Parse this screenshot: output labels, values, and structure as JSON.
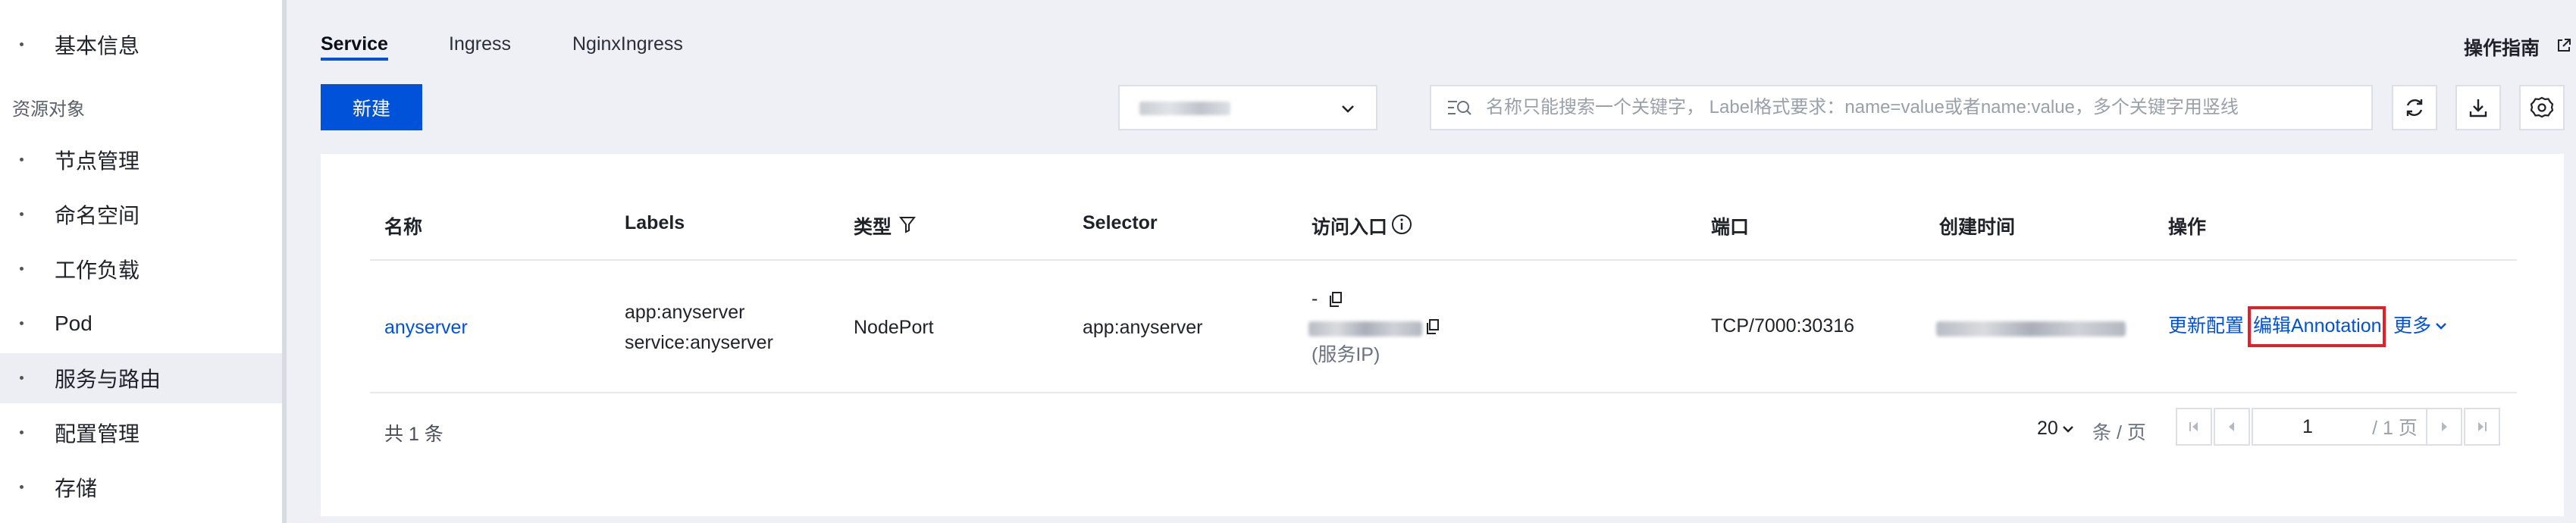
{
  "sidebar": {
    "items_top": [
      {
        "label": "基本信息"
      }
    ],
    "group_label": "资源对象",
    "items": [
      {
        "label": "节点管理"
      },
      {
        "label": "命名空间"
      },
      {
        "label": "工作负载"
      },
      {
        "label": "Pod"
      },
      {
        "label": "服务与路由",
        "active": true
      },
      {
        "label": "配置管理"
      },
      {
        "label": "存储"
      }
    ]
  },
  "tabs": [
    {
      "label": "Service",
      "active": true
    },
    {
      "label": "Ingress"
    },
    {
      "label": "NginxIngress"
    }
  ],
  "guide_link": "操作指南",
  "toolbar": {
    "new_label": "新建",
    "search_placeholder": "名称只能搜索一个关键字， Label格式要求：name=value或者name:value，多个关键字用竖线",
    "icons": [
      "refresh-icon",
      "download-icon",
      "settings-icon"
    ]
  },
  "table": {
    "headers": {
      "name": "名称",
      "labels": "Labels",
      "type": "类型",
      "selector": "Selector",
      "access": "访问入口",
      "port": "端口",
      "created": "创建时间",
      "actions": "操作"
    },
    "rows": [
      {
        "name": "anyserver",
        "labels": [
          "app:anyserver",
          "service:anyserver"
        ],
        "type": "NodePort",
        "selector": "app:anyserver",
        "access_line1": "-",
        "access_note": "(服务IP)",
        "port": "TCP/7000:30316",
        "actions": {
          "update": "更新配置",
          "edit_annotation": "编辑Annotation",
          "more": "更多"
        }
      }
    ]
  },
  "pagination": {
    "total": "共 1 条",
    "page_size": "20",
    "page_size_unit": "条 / 页",
    "current_page": "1",
    "of_pages": "/ 1 页"
  },
  "colors": {
    "primary": "#0052d9",
    "highlight_border": "#e0202b"
  }
}
